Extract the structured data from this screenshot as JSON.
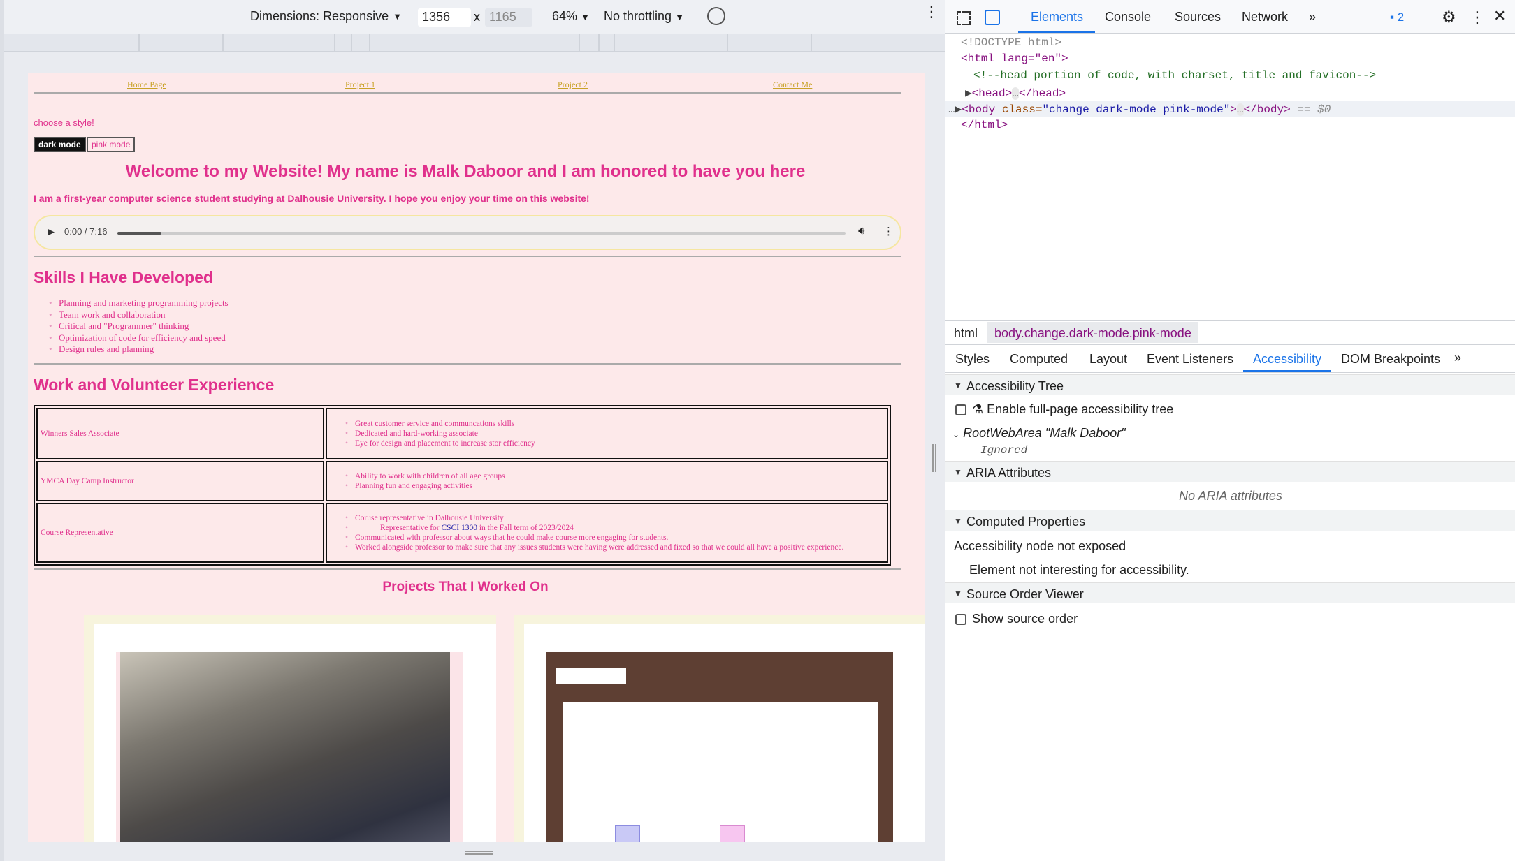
{
  "toolbar": {
    "dimensions_label": "Dimensions: Responsive",
    "width": "1356",
    "height": "1165",
    "times": "x",
    "zoom": "64%",
    "throttling": "No throttling"
  },
  "site": {
    "nav": [
      "Home Page",
      "Project 1",
      "Project 2",
      "Contact Me"
    ],
    "choose_style": "choose a style!",
    "dark_btn": "dark mode",
    "pink_btn": "pink mode",
    "welcome": "Welcome to my Website! My name is Malk Daboor and I am honored to have you here",
    "intro": "I am a first-year computer science student studying at Dalhousie University. I hope you enjoy your time on this website!",
    "audio_time": "0:00 / 7:16",
    "audio_progress": 0.06,
    "skills_title": "Skills I Have Developed",
    "skills": [
      "Planning and marketing programming projects",
      "Team work and collaboration",
      "Critical and \"Programmer\" thinking",
      "Optimization of code for efficiency and speed",
      "Design rules and planning"
    ],
    "work_title": "Work and Volunteer Experience",
    "jobs": [
      {
        "role": "Winners Sales Associate",
        "items": [
          "Great customer service and communcations skills",
          "Dedicated and hard-working associate",
          "Eye for design and placement to increase stor efficiency"
        ]
      },
      {
        "role": "YMCA Day Camp Instructor",
        "items": [
          "Ability to work with children of all age groups",
          "Planning fun and engaging activities"
        ]
      },
      {
        "role": "Course Representative",
        "items": [
          "Coruse representative in Dalhousie University",
          "Communicated with professor about ways that he could make course more engaging for students.",
          "Worked alongside professor to make sure that any issues students were having were addressed and fixed so that we could all have a positive experience."
        ],
        "sub_pre": "Representative for ",
        "sub_link": "CSCI 1300",
        "sub_post": " in the Fall term of 2023/2024"
      }
    ],
    "projects_title": "Projects That I Worked On"
  },
  "devtools": {
    "tabs": [
      "Elements",
      "Console",
      "Sources",
      "Network"
    ],
    "issues_count": "2",
    "dom": {
      "doctype": "<!DOCTYPE html>",
      "html_open": "<html lang=\"en\">",
      "comment": "<!--head portion of code, with charset, title and favicon-->",
      "head": "<head>",
      "head_close": "</head>",
      "body_tag": "<body ",
      "body_attr": "class=",
      "body_val": "\"change dark-mode pink-mode\"",
      "body_close": "</body>",
      "body_suffix": "== $0",
      "html_close": "</html>"
    },
    "breadcrumbs": [
      "html",
      "body.change.dark-mode.pink-mode"
    ],
    "subtabs": [
      "Styles",
      "Computed",
      "Layout",
      "Event Listeners",
      "Accessibility",
      "DOM Breakpoints"
    ],
    "acc_tree": "Accessibility Tree",
    "enable_tree": "Enable full-page accessibility tree",
    "root_area": "RootWebArea \"Malk Daboor\"",
    "ignored": "Ignored",
    "aria": "ARIA Attributes",
    "no_aria": "No ARIA attributes",
    "computed": "Computed Properties",
    "not_exposed": "Accessibility node not exposed",
    "not_interesting": "Element not interesting for accessibility.",
    "source_order": "Source Order Viewer",
    "show_order": "Show source order"
  }
}
